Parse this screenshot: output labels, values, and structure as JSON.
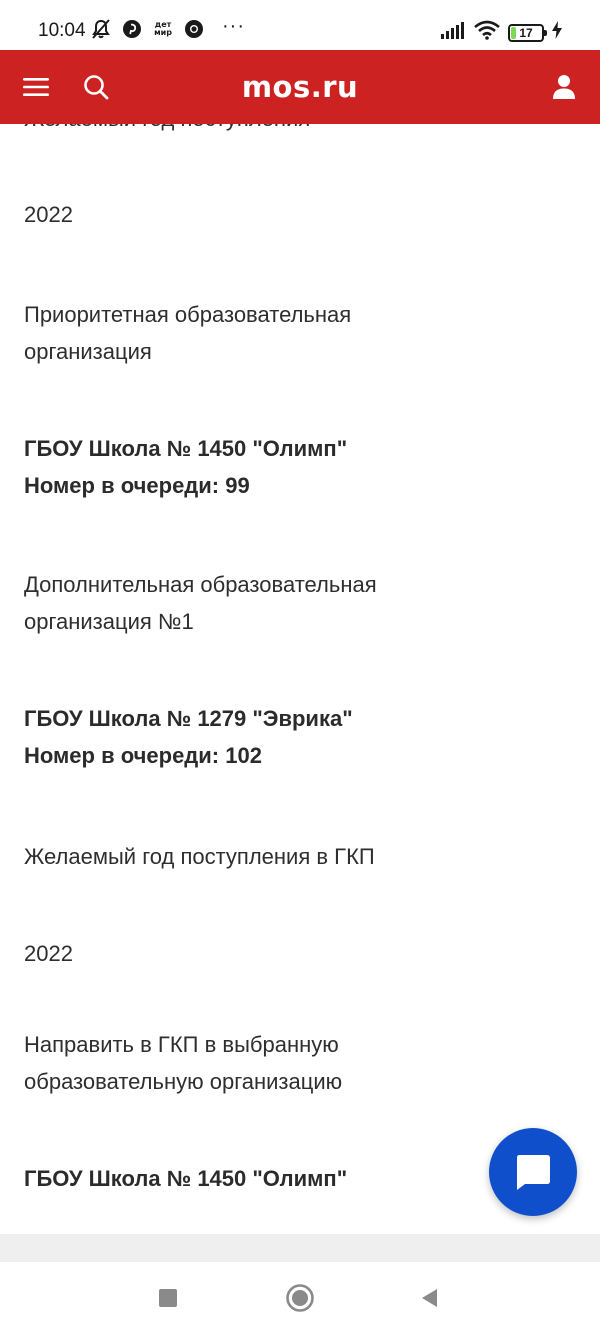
{
  "status_bar": {
    "time": "10:04",
    "mini_app_text": "дет мир",
    "battery_level": "17",
    "battery_fraction": 0.17
  },
  "header": {
    "title": "mos.ru",
    "menu_icon": "hamburger-menu-icon",
    "search_icon": "search-icon",
    "user_icon": "user-icon",
    "brand_color": "#cc2222"
  },
  "content": {
    "cut_label": "Желаемый год поступления",
    "fields": [
      {
        "text": "2022",
        "bold": false
      },
      {
        "text": "Приоритетная образовательная организация",
        "bold": false
      },
      {
        "text": "ГБОУ Школа № 1450 \"Олимп\"",
        "bold": true
      },
      {
        "text": "Номер в очереди: 99",
        "bold": true
      },
      {
        "text": "Дополнительная образовательная организация №1",
        "bold": false
      },
      {
        "text": "ГБОУ Школа № 1279 \"Эврика\"",
        "bold": true
      },
      {
        "text": "Номер в очереди: 102",
        "bold": true
      },
      {
        "text": "Желаемый год поступления в ГКП",
        "bold": false
      },
      {
        "text": "2022",
        "bold": false
      },
      {
        "text": "Направить в ГКП в выбранную образовательную организацию",
        "bold": false
      },
      {
        "text": "ГБОУ Школа № 1450 \"Олимп\"",
        "bold": true
      }
    ]
  },
  "chat_fab": {
    "icon": "chat-bubble-icon",
    "color": "#0f4fcc"
  },
  "nav_bar": {
    "recents_icon": "square-recents-icon",
    "home_icon": "circle-home-icon",
    "back_icon": "triangle-back-icon"
  }
}
